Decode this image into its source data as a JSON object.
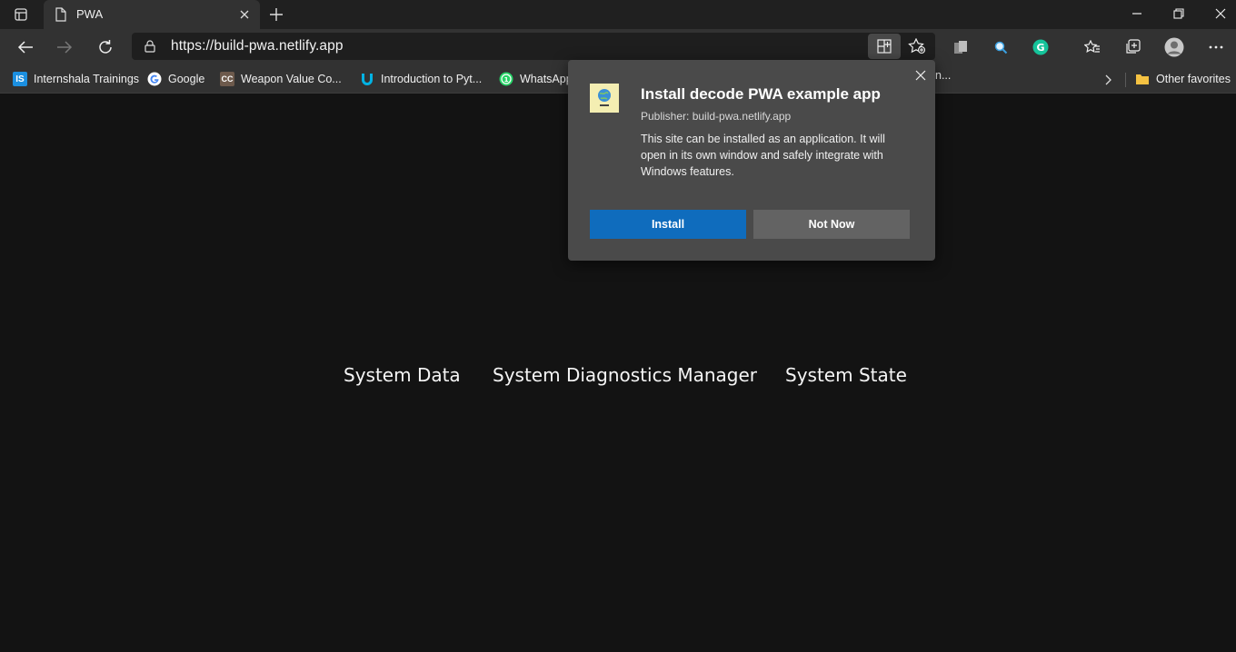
{
  "tab": {
    "title": "PWA"
  },
  "address": {
    "url": "https://build-pwa.netlify.app"
  },
  "bookmarks": [
    {
      "label": "Internshala Trainings",
      "icon": "IS",
      "color": "#1b8fe0"
    },
    {
      "label": "Google",
      "icon": "google-icon"
    },
    {
      "label": "Weapon Value   Co...",
      "icon": "CC",
      "color": "#6d5a4c"
    },
    {
      "label": "Introduction to Pyt...",
      "icon": "udacity-icon",
      "color": "#02b3e4"
    },
    {
      "label": "WhatsApp",
      "icon": "whatsapp-icon",
      "color": "#25d366"
    }
  ],
  "hidden_bookmark_tail": "n...",
  "other_favorites": "Other favorites",
  "page": {
    "links": [
      "System Data",
      "System Diagnostics Manager",
      "System State"
    ]
  },
  "dialog": {
    "title": "Install decode PWA example app",
    "publisher": "Publisher: build-pwa.netlify.app",
    "description": "This site can be installed as an application. It will open in its own window and safely integrate with Windows features.",
    "install_label": "Install",
    "not_now_label": "Not Now"
  },
  "colors": {
    "accent": "#0f6cbd",
    "background": "#131313",
    "toolbar": "#323232"
  }
}
